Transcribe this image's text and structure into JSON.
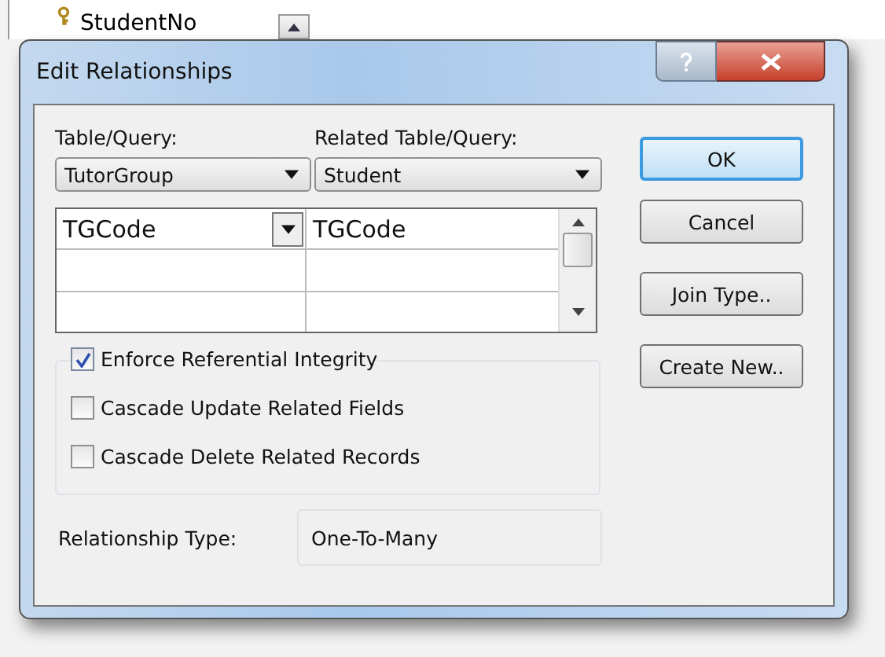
{
  "background_table": {
    "field": "StudentNo"
  },
  "window": {
    "title": "Edit Relationships"
  },
  "table_query": {
    "label": "Table/Query:",
    "value": "TutorGroup"
  },
  "related_table_query": {
    "label": "Related Table/Query:",
    "value": "Student"
  },
  "field_rows": [
    {
      "left": "TGCode",
      "right": "TGCode"
    }
  ],
  "options": [
    {
      "label": "Enforce Referential Integrity",
      "checked": true
    },
    {
      "label": "Cascade Update Related Fields",
      "checked": false
    },
    {
      "label": "Cascade Delete Related Records",
      "checked": false
    }
  ],
  "relationship_type": {
    "label": "Relationship Type:",
    "value": "One-To-Many"
  },
  "buttons": [
    {
      "label": "OK",
      "default": true
    },
    {
      "label": "Cancel",
      "default": false
    },
    {
      "label": "Join Type..",
      "default": false
    },
    {
      "label": "Create New..",
      "default": false
    }
  ]
}
